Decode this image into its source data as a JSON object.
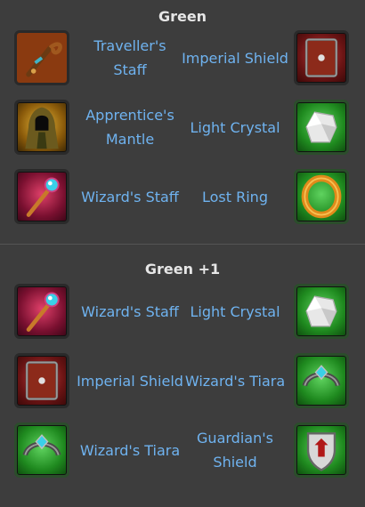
{
  "sections": [
    {
      "title": "Green",
      "rows": [
        {
          "left": {
            "label": "Traveller's Staff",
            "icon": "travellers-staff-icon"
          },
          "right": {
            "label": "Imperial Shield",
            "icon": "imperial-shield-icon"
          }
        },
        {
          "left": {
            "label": "Apprentice's Mantle",
            "icon": "apprentices-mantle-icon"
          },
          "right": {
            "label": "Light Crystal",
            "icon": "light-crystal-icon"
          }
        },
        {
          "left": {
            "label": "Wizard's Staff",
            "icon": "wizards-staff-icon"
          },
          "right": {
            "label": "Lost Ring",
            "icon": "lost-ring-icon"
          }
        }
      ]
    },
    {
      "title": "Green +1",
      "rows": [
        {
          "left": {
            "label": "Wizard's Staff",
            "icon": "wizards-staff-icon"
          },
          "right": {
            "label": "Light Crystal",
            "icon": "light-crystal-icon"
          }
        },
        {
          "left": {
            "label": "Imperial Shield",
            "icon": "imperial-shield-icon"
          },
          "right": {
            "label": "Wizard's Tiara",
            "icon": "wizards-tiara-icon"
          }
        },
        {
          "left": {
            "label": "Wizard's Tiara",
            "icon": "wizards-tiara-icon"
          },
          "right": {
            "label": "Guardian's Shield",
            "icon": "guardians-shield-icon"
          }
        }
      ]
    }
  ],
  "colors": {
    "background": "#3d3d3d",
    "label": "#6fb3f0",
    "title": "#e6e6e6"
  }
}
